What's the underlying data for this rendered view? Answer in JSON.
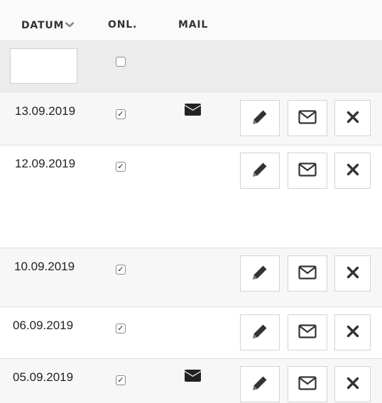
{
  "header": {
    "datum_label": "DATUM",
    "onl_label": "ONL.",
    "mail_label": "MAIL",
    "sort_icon": "chevron-down-icon"
  },
  "filter": {
    "date_value": "",
    "online_checked": false
  },
  "colors": {
    "header_bg": "#fafafa",
    "filter_bg": "#ececec",
    "alt_row_bg": "#f7f7f7",
    "icon": "#333333"
  },
  "rows": [
    {
      "date": "13.09.2019",
      "online": true,
      "mail_sent": true,
      "actions": [
        "pencil-icon",
        "envelope-icon",
        "close-icon"
      ]
    },
    {
      "date": "12.09.2019",
      "online": true,
      "mail_sent": false,
      "actions": [
        "pencil-icon",
        "envelope-icon",
        "close-icon"
      ]
    },
    {
      "date": "10.09.2019",
      "online": true,
      "mail_sent": false,
      "actions": [
        "pencil-icon",
        "envelope-icon",
        "close-icon"
      ]
    },
    {
      "date": "06.09.2019",
      "online": true,
      "mail_sent": false,
      "actions": [
        "pencil-icon",
        "envelope-icon",
        "close-icon"
      ]
    },
    {
      "date": "05.09.2019",
      "online": true,
      "mail_sent": true,
      "actions": [
        "pencil-icon",
        "envelope-icon",
        "close-icon"
      ]
    }
  ]
}
